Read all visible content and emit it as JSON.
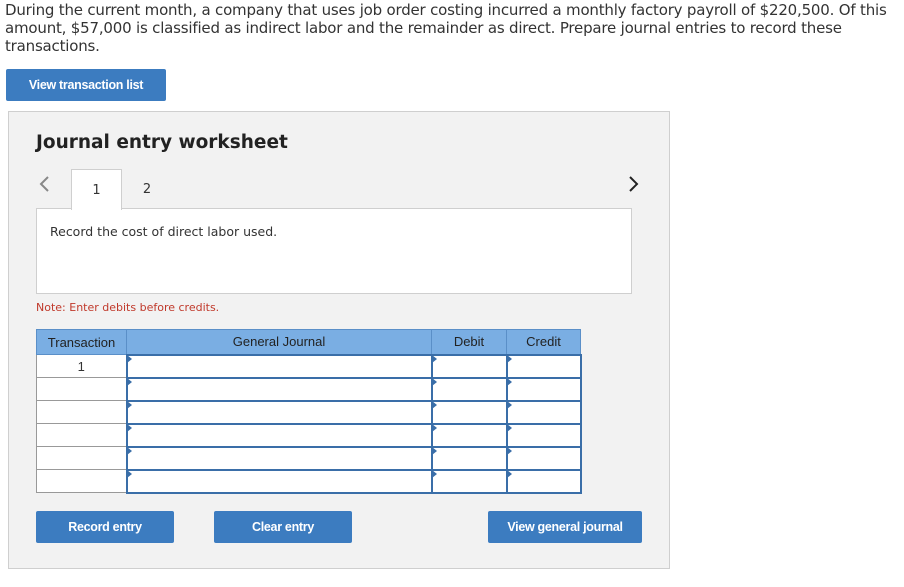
{
  "question": {
    "text": "During the current month, a company that uses job order costing incurred a monthly factory payroll of $220,500. Of this amount, $57,000 is classified as indirect labor and the remainder as direct. Prepare journal entries to record these transactions."
  },
  "toolbar": {
    "view_transaction_list_label": "View transaction list"
  },
  "worksheet": {
    "title": "Journal entry worksheet",
    "nav_prev_icon": "chevron-left-icon",
    "nav_next_icon": "chevron-right-icon",
    "tabs": [
      {
        "label": "1",
        "active": true
      },
      {
        "label": "2",
        "active": false
      }
    ],
    "description": "Record the cost of direct labor used.",
    "note": "Note: Enter debits before credits.",
    "table": {
      "headers": [
        "Transaction",
        "General Journal",
        "Debit",
        "Credit"
      ],
      "rows": [
        {
          "transaction": "1",
          "general_journal": "",
          "debit": "",
          "credit": ""
        },
        {
          "transaction": "",
          "general_journal": "",
          "debit": "",
          "credit": ""
        },
        {
          "transaction": "",
          "general_journal": "",
          "debit": "",
          "credit": ""
        },
        {
          "transaction": "",
          "general_journal": "",
          "debit": "",
          "credit": ""
        },
        {
          "transaction": "",
          "general_journal": "",
          "debit": "",
          "credit": ""
        },
        {
          "transaction": "",
          "general_journal": "",
          "debit": "",
          "credit": ""
        }
      ]
    },
    "buttons": {
      "record_entry": "Record entry",
      "clear_entry": "Clear entry",
      "view_general_journal": "View general journal"
    }
  },
  "colors": {
    "button_blue": "#3c7cc0",
    "header_blue": "#7aaee3",
    "note_red": "#c0392b"
  }
}
